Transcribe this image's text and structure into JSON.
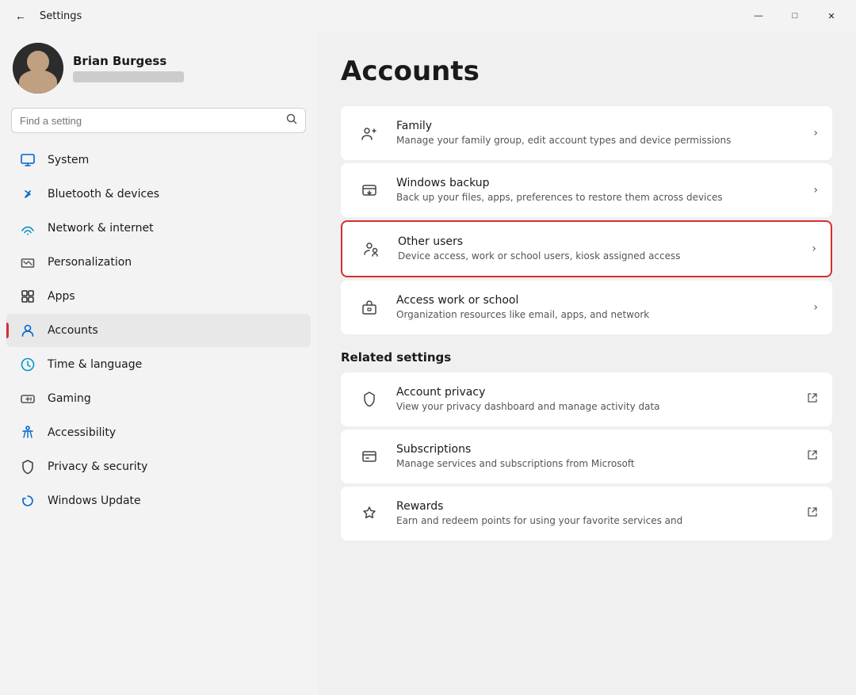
{
  "titlebar": {
    "title": "Settings",
    "back_label": "←",
    "minimize_label": "—",
    "maximize_label": "□",
    "close_label": "✕"
  },
  "sidebar": {
    "search_placeholder": "Find a setting",
    "user": {
      "name": "Brian Burgess",
      "email_placeholder": "••••••••••••••"
    },
    "nav_items": [
      {
        "id": "system",
        "label": "System",
        "icon": "system"
      },
      {
        "id": "bluetooth",
        "label": "Bluetooth & devices",
        "icon": "bluetooth"
      },
      {
        "id": "network",
        "label": "Network & internet",
        "icon": "network"
      },
      {
        "id": "personalization",
        "label": "Personalization",
        "icon": "personalization"
      },
      {
        "id": "apps",
        "label": "Apps",
        "icon": "apps"
      },
      {
        "id": "accounts",
        "label": "Accounts",
        "icon": "accounts",
        "active": true
      },
      {
        "id": "time",
        "label": "Time & language",
        "icon": "time"
      },
      {
        "id": "gaming",
        "label": "Gaming",
        "icon": "gaming"
      },
      {
        "id": "accessibility",
        "label": "Accessibility",
        "icon": "accessibility"
      },
      {
        "id": "privacy",
        "label": "Privacy & security",
        "icon": "privacy"
      },
      {
        "id": "update",
        "label": "Windows Update",
        "icon": "update"
      }
    ]
  },
  "content": {
    "page_title": "Accounts",
    "cards": [
      {
        "id": "family",
        "title": "Family",
        "description": "Manage your family group, edit account types and device permissions",
        "arrow": "›",
        "highlighted": false
      },
      {
        "id": "windows-backup",
        "title": "Windows backup",
        "description": "Back up your files, apps, preferences to restore them across devices",
        "arrow": "›",
        "highlighted": false
      },
      {
        "id": "other-users",
        "title": "Other users",
        "description": "Device access, work or school users, kiosk assigned access",
        "arrow": "›",
        "highlighted": true
      },
      {
        "id": "access-work",
        "title": "Access work or school",
        "description": "Organization resources like email, apps, and network",
        "arrow": "›",
        "highlighted": false
      }
    ],
    "related_settings_title": "Related settings",
    "related_cards": [
      {
        "id": "account-privacy",
        "title": "Account privacy",
        "description": "View your privacy dashboard and manage activity data",
        "external": true
      },
      {
        "id": "subscriptions",
        "title": "Subscriptions",
        "description": "Manage services and subscriptions from Microsoft",
        "external": true
      },
      {
        "id": "rewards",
        "title": "Rewards",
        "description": "Earn and redeem points for using your favorite services and",
        "external": true
      }
    ]
  }
}
